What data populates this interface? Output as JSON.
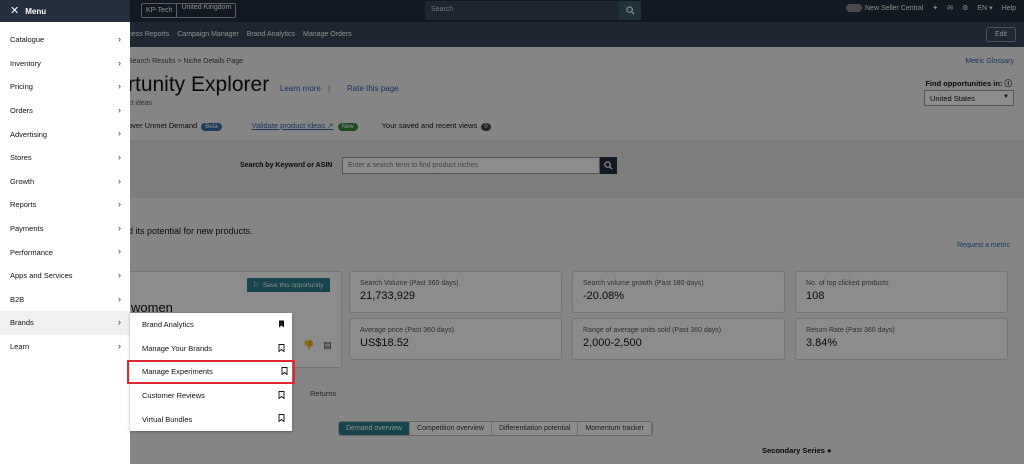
{
  "topbar": {
    "store_name": "KP-Tech",
    "store_region": "United Kingdom",
    "search_placeholder": "Search",
    "new_seller_central": "New Seller Central",
    "language": "EN",
    "help": "Help"
  },
  "subnav": {
    "items": [
      "ness Reports",
      "Campaign Manager",
      "Brand Analytics",
      "Manage Orders"
    ],
    "edit": "Edit"
  },
  "page": {
    "breadcrumb": "Search Results  >  Niche Details Page",
    "metric_glossary": "Metric Glossary",
    "title": "rtunity Explorer",
    "learn_more": "Learn more",
    "title_sep": "|",
    "rate_page": "Rate this page",
    "subtitle": "ct ideas",
    "find_label": "Find opportunities in:",
    "country": "United States",
    "tab_uncover": "over Unmet Demand",
    "tab_uncover_badge": "Beta",
    "tab_validate": "Validate product ideas ↗",
    "tab_validate_badge": "New",
    "tab_saved": "Your saved and recent views",
    "tab_saved_count": "0",
    "search_label": "Search by Keyword or ASIN",
    "search_placeholder": "Enter a search term to find product niches",
    "potential_text": "d its potential for new products.",
    "request_metric": "Request a metric",
    "save_opportunity": "Save this opportunity",
    "niche_name": "women",
    "returns_tab": "Returns",
    "seg_tabs": [
      "Demand overview",
      "Competition overview",
      "Differentiation potential",
      "Momentum tracker"
    ],
    "secondary_series": "Secondary Series ●"
  },
  "metrics": [
    {
      "label": "Search Volume (Past 360 days)",
      "value": "21,733,929"
    },
    {
      "label": "Search volume growth (Past 180 days)",
      "value": "-20.08%"
    },
    {
      "label": "No. of top clicked products",
      "value": "108"
    },
    {
      "label": "Average price (Past 360 days)",
      "value": "US$18.52"
    },
    {
      "label": "Range of average units sold (Past 360 days)",
      "value": "2,000-2,500"
    },
    {
      "label": "Return Rate (Past 360 days)",
      "value": "3.84%"
    }
  ],
  "menu": {
    "close_icon": "close-icon",
    "title": "Menu",
    "items": [
      "Catalogue",
      "Inventory",
      "Pricing",
      "Orders",
      "Advertising",
      "Stores",
      "Growth",
      "Reports",
      "Payments",
      "Performance",
      "Apps and Services",
      "B2B",
      "Brands",
      "Learn"
    ],
    "active": "Brands"
  },
  "submenu": {
    "items": [
      {
        "label": "Brand Analytics",
        "bookmarked": true
      },
      {
        "label": "Manage Your Brands",
        "bookmarked": false
      },
      {
        "label": "Manage Experiments",
        "bookmarked": false
      },
      {
        "label": "Customer Reviews",
        "bookmarked": false
      },
      {
        "label": "Virtual Bundles",
        "bookmarked": false
      }
    ],
    "highlighted": "Manage Experiments",
    "highlight_color": "#e0262f"
  },
  "colors": {
    "header_bg": "#232f3e",
    "accent_teal": "#2a7f8f",
    "link": "#2a5db0"
  }
}
